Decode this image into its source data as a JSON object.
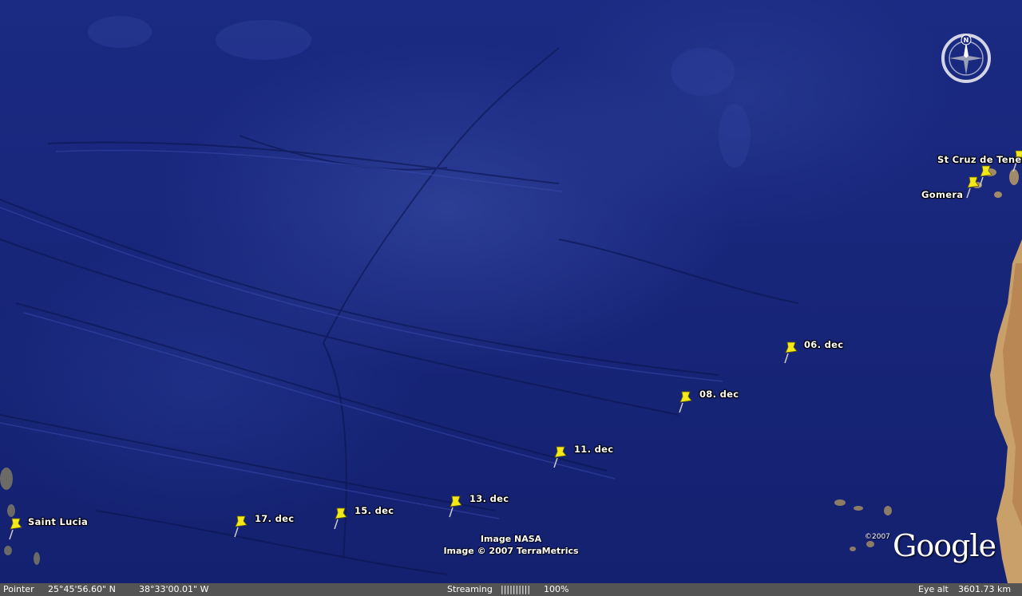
{
  "map": {
    "placemarks": [
      {
        "label": "St Cruz de Tener"
      },
      {
        "label": "Gomera"
      },
      {
        "label": "06. dec"
      },
      {
        "label": "08. dec"
      },
      {
        "label": "11. dec"
      },
      {
        "label": "13. dec"
      },
      {
        "label": "15. dec"
      },
      {
        "label": "17. dec"
      },
      {
        "label": "Saint Lucia"
      }
    ],
    "credits": {
      "line1": "Image NASA",
      "line2": "Image © 2007 TerraMetrics"
    },
    "logo": "Google",
    "copyright": "©2007",
    "compass_north": "N"
  },
  "statusbar": {
    "pointer_label": "Pointer",
    "latitude": "25°45'56.60\" N",
    "longitude": "38°33'00.01\" W",
    "streaming_label": "Streaming",
    "streaming_bar": "||||||||||",
    "streaming_percent": "100%",
    "eye_alt_label": "Eye alt",
    "eye_alt_value": "3601.73 km"
  },
  "colors": {
    "ocean": "#18267a",
    "pin": "#f2e81a",
    "land": "#c9a06a",
    "statusbar": "#545454"
  }
}
